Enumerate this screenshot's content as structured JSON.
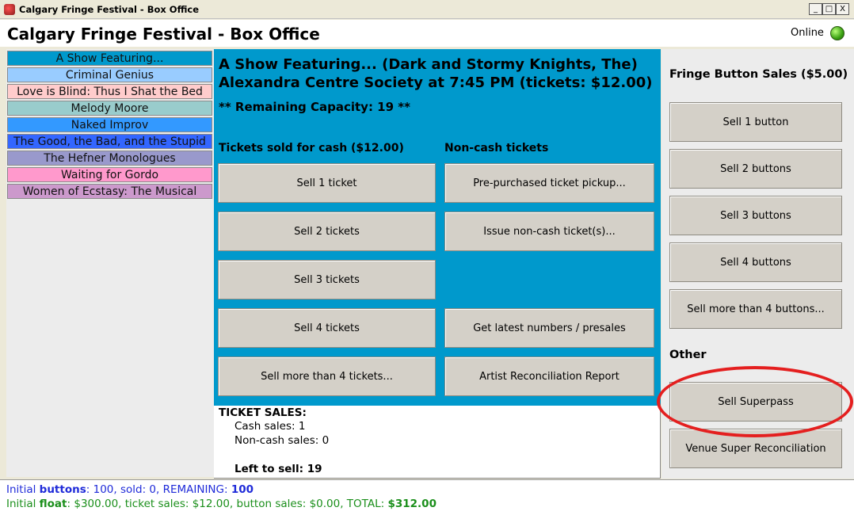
{
  "window": {
    "title": "Calgary Fringe Festival - Box Office",
    "controls": {
      "minimize": "_",
      "maximize": "□",
      "close": "X"
    }
  },
  "header": {
    "title": "Calgary Fringe Festival - Box Office",
    "online_label": "Online",
    "online_color": "#3aa012"
  },
  "shows": [
    {
      "label": "A Show Featuring...",
      "color": "#0099cc"
    },
    {
      "label": "Criminal Genius",
      "color": "#99ccff"
    },
    {
      "label": "Love is Blind: Thus I Shat the Bed",
      "color": "#ffcccc"
    },
    {
      "label": "Melody Moore",
      "color": "#99cccc"
    },
    {
      "label": "Naked Improv",
      "color": "#3399ff"
    },
    {
      "label": "The Good, the Bad, and the Stupid",
      "color": "#3366ff"
    },
    {
      "label": "The Hefner Monologues",
      "color": "#9999cc"
    },
    {
      "label": "Waiting for Gordo",
      "color": "#ff99cc"
    },
    {
      "label": "Women of Ecstasy: The Musical",
      "color": "#cc99cc"
    }
  ],
  "center": {
    "heading_line1": "A Show Featuring... (Dark and Stormy Knights, The)",
    "heading_line2": "Alexandra Centre Society at 7:45 PM (tickets: $12.00)",
    "capacity": "** Remaining Capacity: 19 **",
    "cash_header": "Tickets sold for cash ($12.00)",
    "noncash_header": "Non-cash tickets",
    "cash_buttons": [
      "Sell 1 ticket",
      "Sell 2 tickets",
      "Sell 3 tickets",
      "Sell 4 tickets",
      "Sell more than 4 tickets..."
    ],
    "noncash_buttons": {
      "pickup": "Pre-purchased ticket pickup...",
      "issue": "Issue non-cash ticket(s)...",
      "latest": "Get latest numbers / presales",
      "report": "Artist Reconciliation Report"
    }
  },
  "ticket_sales": {
    "heading": "TICKET SALES:",
    "cash": "Cash sales: 1",
    "noncash": "Non-cash sales: 0",
    "left": "Left to sell: 19"
  },
  "right": {
    "button_header": "Fringe Button Sales ($5.00)",
    "button_sales": [
      "Sell 1 button",
      "Sell 2 buttons",
      "Sell 3 buttons",
      "Sell 4 buttons",
      "Sell more than 4 buttons..."
    ],
    "other_header": "Other",
    "superpass": "Sell Superpass",
    "venue_recon": "Venue Super Reconciliation"
  },
  "status": {
    "row1": {
      "initial": "Initial ",
      "buttons_label": "buttons",
      "mid": ": 100, sold: 0, REMAINING: ",
      "remaining": "100"
    },
    "row2": {
      "initial": "Initial ",
      "float_label": "float",
      "mid": ": $300.00, ticket sales: $12.00, button sales: $0.00, TOTAL: ",
      "total": "$312.00"
    }
  },
  "colors": {
    "center_bg": "#0099cc",
    "button_face": "#d4d0c8",
    "highlight": "#e41f1f",
    "status_blue": "#1f2bd9",
    "status_green": "#1b8f1b"
  }
}
